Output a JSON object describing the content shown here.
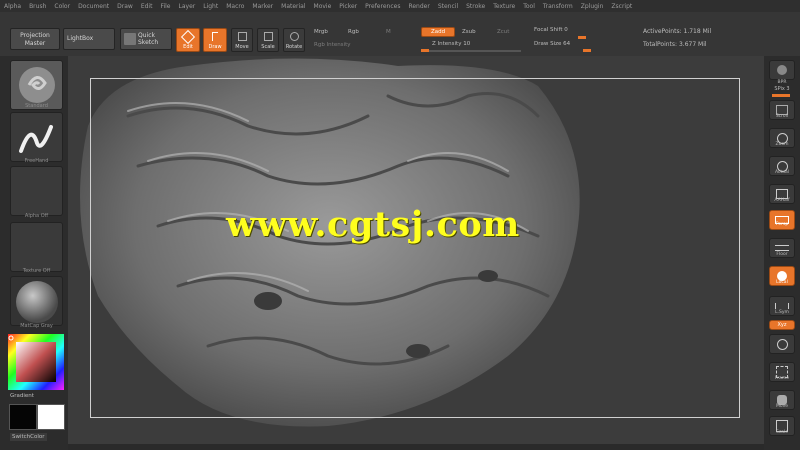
{
  "menu": [
    "Alpha",
    "Brush",
    "Color",
    "Document",
    "Draw",
    "Edit",
    "File",
    "Layer",
    "Light",
    "Macro",
    "Marker",
    "Material",
    "Movie",
    "Picker",
    "Preferences",
    "Render",
    "Stencil",
    "Stroke",
    "Texture",
    "Tool",
    "Transform",
    "Zplugin",
    "Zscript"
  ],
  "toolbar": {
    "projection_master": "Projection Master",
    "lightbox": "LightBox",
    "quick_sketch": "Quick Sketch",
    "edit": "Edit",
    "draw": "Draw",
    "move": "Move",
    "scale": "Scale",
    "rotate": "Rotate",
    "mrgb": "Mrgb",
    "rgb": "Rgb",
    "m": "M",
    "rgb_intensity": "Rgb Intensity",
    "zadd": "Zadd",
    "zsub": "Zsub",
    "zcut": "Zcut",
    "z_intensity": "Z Intensity 10",
    "focal_shift": "Focal Shift 0",
    "draw_size": "Draw Size 64",
    "active_points": "ActivePoints: 1.718 Mil",
    "total_points": "TotalPoints: 3.677 Mil"
  },
  "left_panel": {
    "labels": [
      "Standard",
      "FreeHand",
      "Alpha Off",
      "Texture Off",
      "MatCap Gray"
    ],
    "gradient": "Gradient",
    "switch_color": "SwitchColor"
  },
  "right_panel": {
    "labels": [
      "BPR",
      "SPix 3",
      "Scroll",
      "Zoom",
      "Actual",
      "AAHalf",
      "Persp",
      "Floor",
      "Local",
      "L.Sym",
      "Xyz",
      "",
      "Frame",
      "Move",
      "Scale"
    ]
  },
  "watermark": "www.cgtsj.com",
  "colors": {
    "accent": "#e8752a",
    "watermark": "#ffff1e",
    "viewport_bg": "#3c3c3c"
  }
}
